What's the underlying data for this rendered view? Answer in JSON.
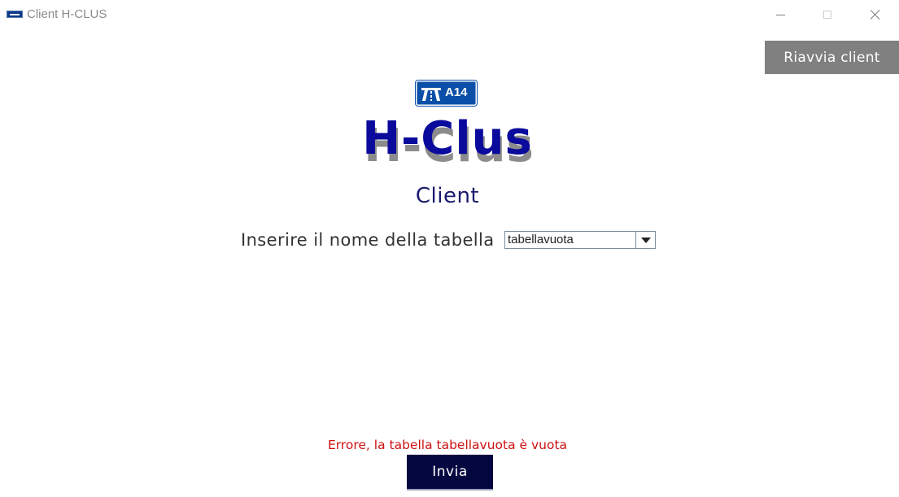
{
  "window": {
    "title": "Client H-CLUS",
    "icon": "motorway-sign-icon"
  },
  "toolbar": {
    "restart_label": "Riavvia client"
  },
  "logo": {
    "text": "A14",
    "color": "#0b4fa8"
  },
  "header": {
    "title": "H-Clus",
    "subtitle": "Client",
    "title_color": "#0a0a9c"
  },
  "form": {
    "prompt_label": "Inserire il nome della tabella",
    "table_select": {
      "selected_value": "tabellavuota"
    },
    "error_message": "Errore, la tabella tabellavuota è vuota",
    "error_color": "#cc1111",
    "submit_label": "Invia"
  }
}
